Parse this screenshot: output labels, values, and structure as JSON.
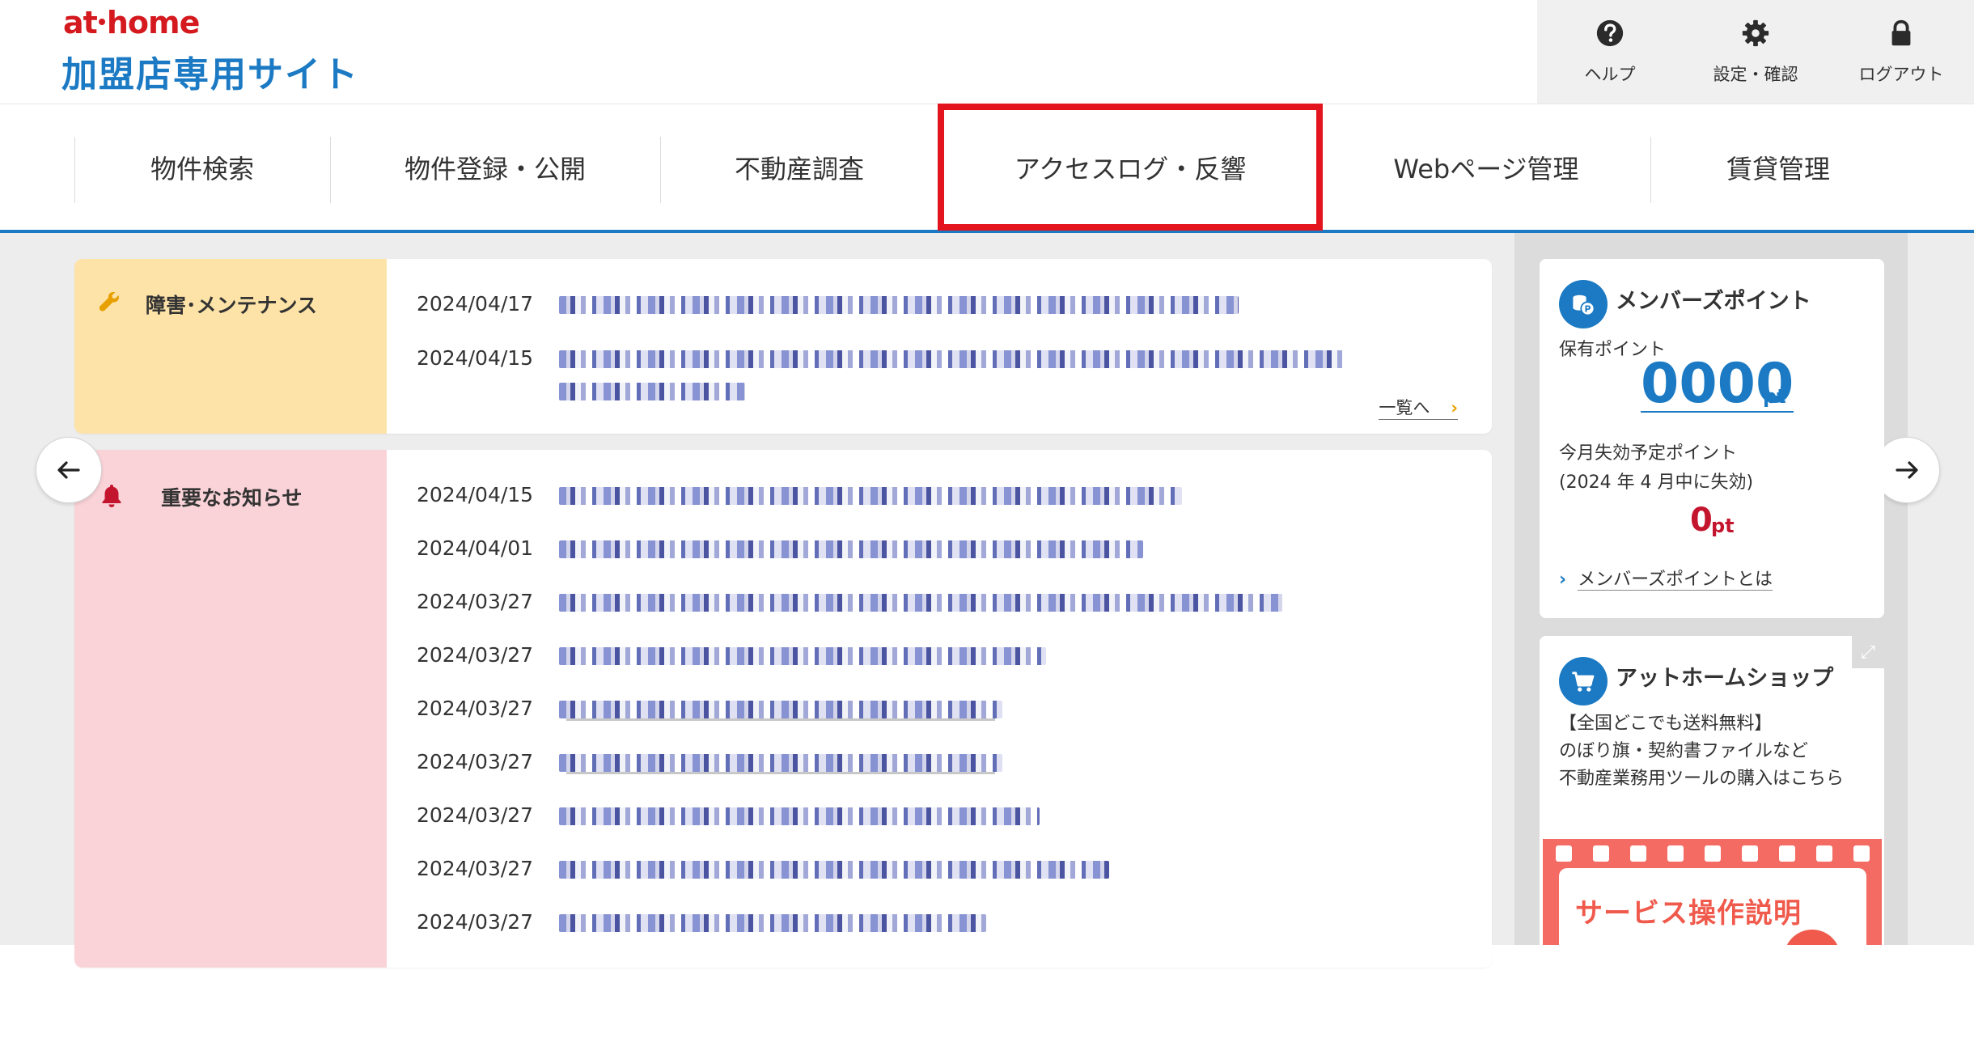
{
  "header": {
    "brand": "at home",
    "brand_left": "at",
    "brand_right": "home",
    "site_title": "加盟店専用サイト",
    "help_label": "ヘルプ",
    "settings_label": "設定・確認",
    "logout_label": "ログアウト"
  },
  "nav": {
    "items": [
      {
        "label": "物件検索"
      },
      {
        "label": "物件登録・公開"
      },
      {
        "label": "不動産調査"
      },
      {
        "label": "アクセスログ・反響"
      },
      {
        "label": "Webページ管理"
      },
      {
        "label": "賃貸管理"
      }
    ],
    "highlighted_index": 3,
    "highlight_color": "#e3141e"
  },
  "maintenance": {
    "title": "障害･メンテナンス",
    "bg_color": "#fde3a8",
    "rows": [
      {
        "date": "2024/04/17"
      },
      {
        "date": "2024/04/15"
      }
    ],
    "more_label": "一覧へ"
  },
  "notices": {
    "title": "重要なお知らせ",
    "bg_color": "#fad3d8",
    "rows": [
      {
        "date": "2024/04/15"
      },
      {
        "date": "2024/04/01"
      },
      {
        "date": "2024/03/27"
      },
      {
        "date": "2024/03/27"
      },
      {
        "date": "2024/03/27"
      },
      {
        "date": "2024/03/27"
      },
      {
        "date": "2024/03/27"
      },
      {
        "date": "2024/03/27"
      },
      {
        "date": "2024/03/27"
      }
    ]
  },
  "members_points": {
    "title": "メンバーズポイント",
    "held_label": "保有ポイント",
    "held_value": "0000",
    "unit": "pt",
    "expiring_label": "今月失効予定ポイント",
    "expiring_note": "(2024 年 4 月中に失効)",
    "expiring_value": "0",
    "link_label": "メンバーズポイントとは"
  },
  "shop": {
    "title": "アットホームショップ",
    "line1": "【全国どこでも送料無料】",
    "line2": "のぼり旗・契約書ファイルなど",
    "line3": "不動産業務用ツールの購入はこちら"
  },
  "banner": {
    "text": "サービス操作説明"
  },
  "colors": {
    "accent_blue": "#1b7ac3",
    "brand_red": "#d4191f",
    "warning_orange": "#e8a000",
    "notice_red": "#c4152e"
  }
}
